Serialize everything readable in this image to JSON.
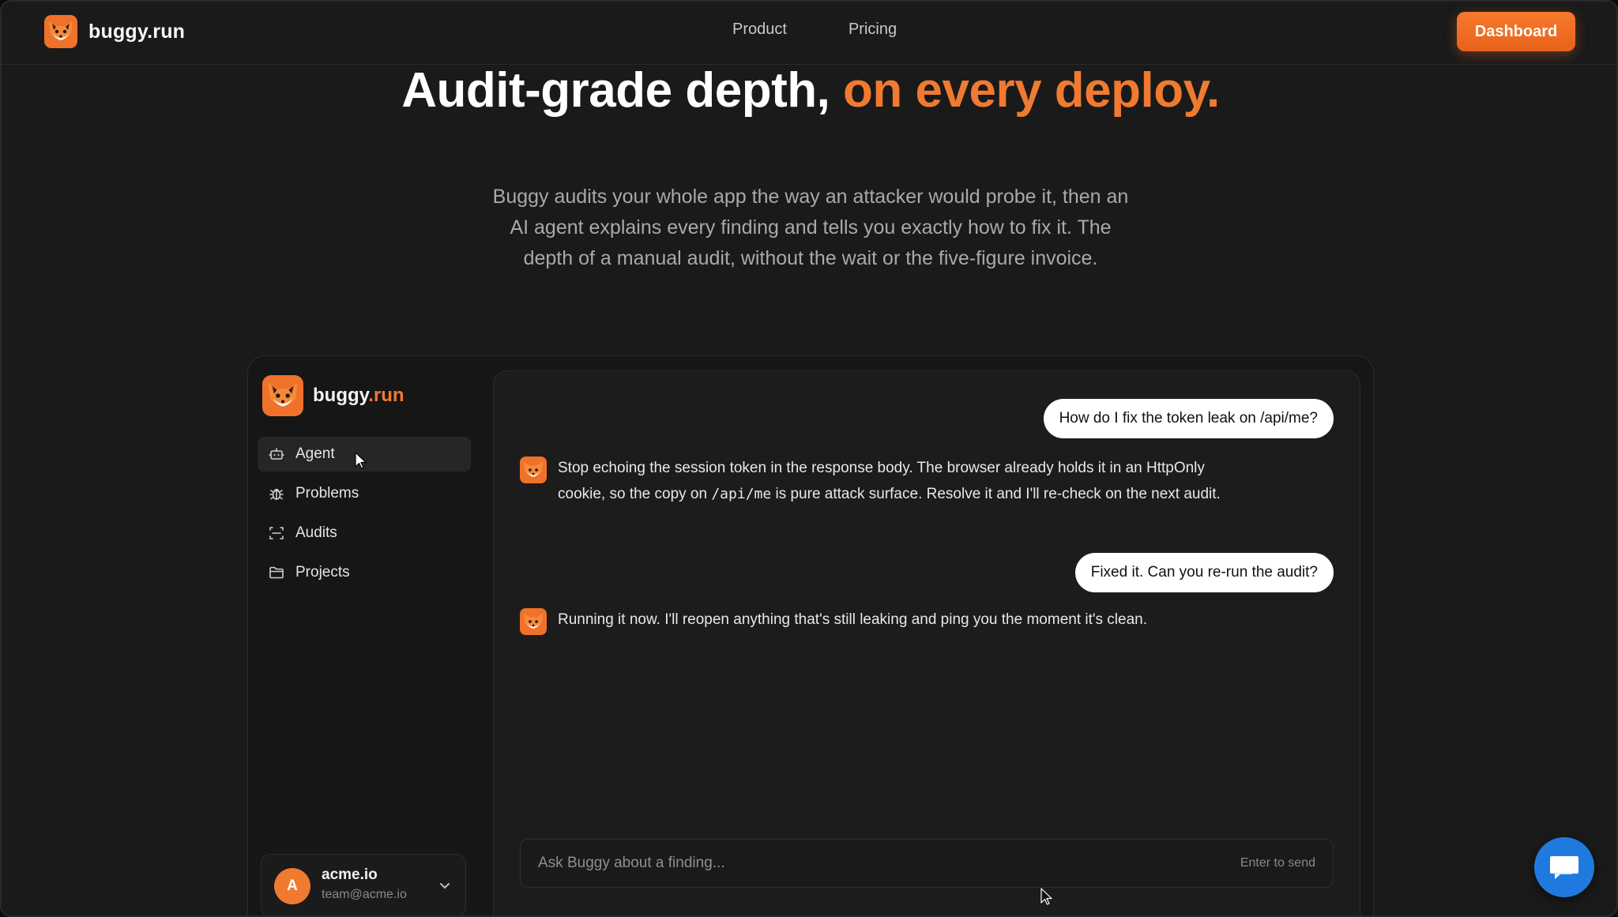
{
  "header": {
    "brand_name": "buggy.run",
    "nav": [
      {
        "label": "Product"
      },
      {
        "label": "Pricing"
      }
    ],
    "dashboard_label": "Dashboard"
  },
  "hero": {
    "title_main": "Audit-grade depth, ",
    "title_accent": "on every deploy.",
    "subtitle": "Buggy audits your whole app the way an attacker would probe it, then an AI agent explains every finding and tells you exactly how to fix it. The depth of a manual audit, without the wait or the five-figure invoice."
  },
  "app": {
    "brand_main": "buggy",
    "brand_tld": ".run",
    "sidebar": [
      {
        "label": "Agent",
        "icon": "robot-icon",
        "active": true
      },
      {
        "label": "Problems",
        "icon": "bug-icon"
      },
      {
        "label": "Audits",
        "icon": "scan-icon"
      },
      {
        "label": "Projects",
        "icon": "folder-icon"
      }
    ],
    "account": {
      "initial": "A",
      "name": "acme.io",
      "email": "team@acme.io"
    },
    "chat": {
      "messages": [
        {
          "role": "user",
          "text": "How do I fix the token leak on /api/me?"
        },
        {
          "role": "bot",
          "text_before": "Stop echoing the session token in the response body. The browser already holds it in an HttpOnly cookie, so the copy on ",
          "code": "/api/me",
          "text_after": " is pure attack surface. Resolve it and I'll re-check on the next audit."
        },
        {
          "role": "user",
          "text": "Fixed it. Can you re-run the audit?"
        },
        {
          "role": "bot",
          "text": "Running it now. I'll reopen anything that's still leaking and ping you the moment it's clean."
        }
      ],
      "input_placeholder": "Ask Buggy about a finding...",
      "input_value": "",
      "input_hint": "Enter to send"
    }
  },
  "colors": {
    "accent": "#f07a30",
    "background": "#1a1a1a",
    "fab": "#1f7ae0"
  }
}
